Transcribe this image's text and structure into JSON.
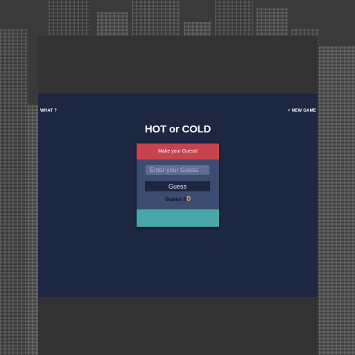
{
  "header": {
    "what_label": "WHAT ?",
    "new_game_label": "+ NEW GAME"
  },
  "game": {
    "title": "HOT or COLD",
    "feedback": "Make your Guess!",
    "input_placeholder": "Enter your Guess",
    "button_label": "Guess",
    "count_label": "Guess #",
    "count_value": "0"
  },
  "colors": {
    "background_dark": "#333333",
    "panel_navy": "#1d2741",
    "card": "#3d4b71",
    "feedback_red": "#c8434f",
    "accent_teal": "#48a7a9",
    "count_orange": "#f1a33d"
  }
}
